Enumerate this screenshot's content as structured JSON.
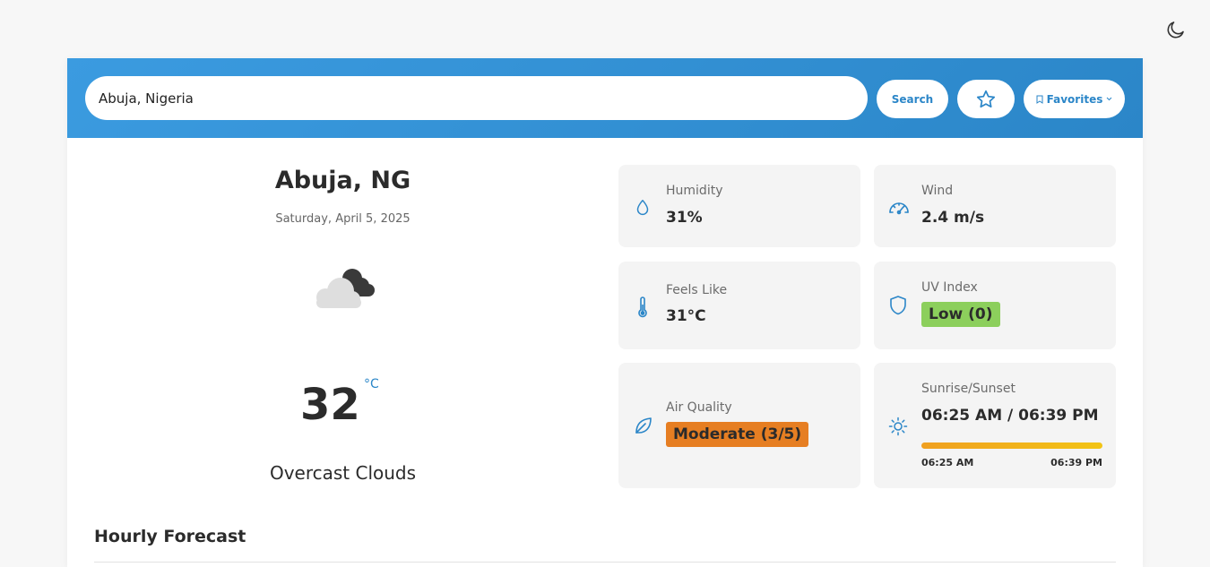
{
  "theme_toggle": {
    "icon": "moon-icon"
  },
  "search": {
    "value": "Abuja, Nigeria",
    "placeholder": "",
    "button_label": "Search"
  },
  "favorites": {
    "label": "Favorites"
  },
  "current": {
    "city": "Abuja, NG",
    "date": "Saturday, April 5, 2025",
    "temperature": "32",
    "unit": "°C",
    "description": "Overcast Clouds",
    "icon": "overcast-clouds-icon"
  },
  "stats": {
    "humidity": {
      "label": "Humidity",
      "value": "31%"
    },
    "wind": {
      "label": "Wind",
      "value": "2.4 m/s"
    },
    "feels_like": {
      "label": "Feels Like",
      "value": "31°C"
    },
    "uv_index": {
      "label": "UV Index",
      "value": "Low (0)",
      "color": "#8ccf5c"
    },
    "air_quality": {
      "label": "Air Quality",
      "value": "Moderate (3/5)",
      "color": "#e67e22"
    },
    "sun": {
      "label": "Sunrise/Sunset",
      "value": "06:25 AM / 06:39 PM",
      "sunrise": "06:25 AM",
      "sunset": "06:39 PM"
    }
  },
  "hourly": {
    "title": "Hourly Forecast"
  },
  "colors": {
    "accent": "#2b86c8",
    "header_start": "#3b9be0",
    "header_end": "#2b86c8"
  }
}
